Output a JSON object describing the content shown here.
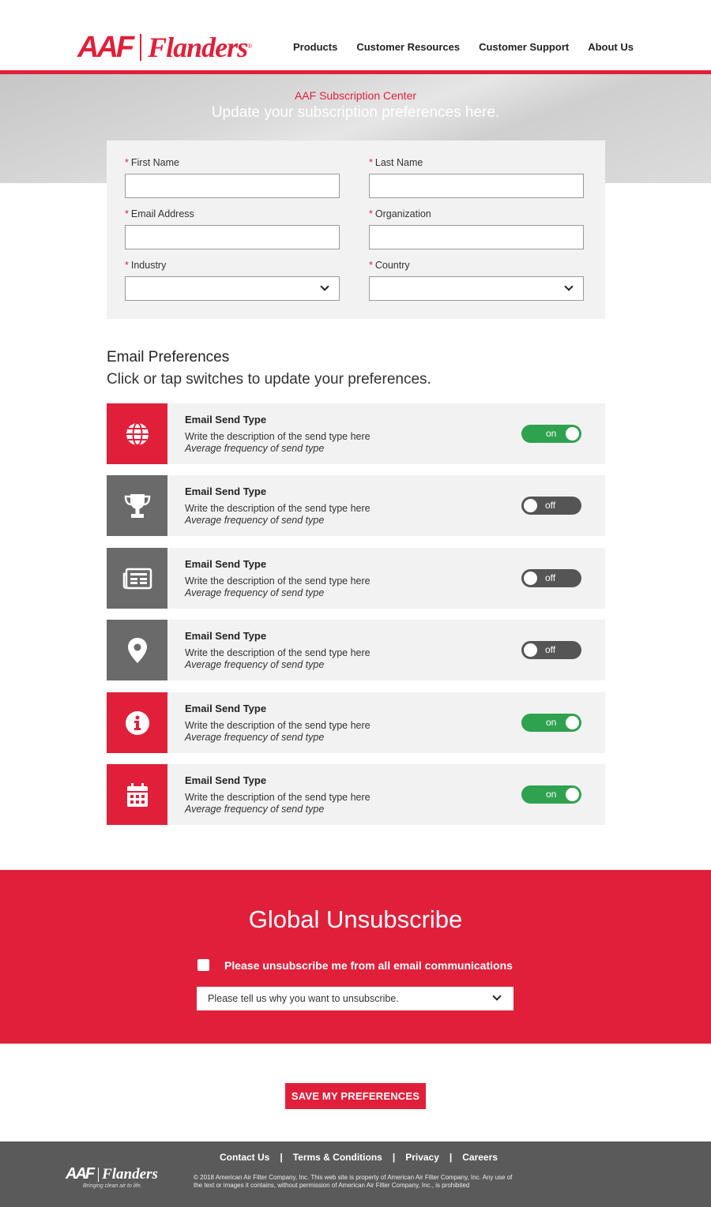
{
  "header": {
    "logo_aaf": "AAF",
    "logo_flanders": "Flanders",
    "logo_reg": "®",
    "nav": [
      "Products",
      "Customer Resources",
      "Customer Support",
      "About Us"
    ]
  },
  "banner": {
    "subtitle": "AAF Subscription Center",
    "title": "Update your subscription preferences here."
  },
  "form": {
    "required_mark": "*",
    "first_name": {
      "label": "First Name",
      "value": ""
    },
    "last_name": {
      "label": "Last Name",
      "value": ""
    },
    "email": {
      "label": "Email Address",
      "value": ""
    },
    "organization": {
      "label": "Organization",
      "value": ""
    },
    "industry": {
      "label": "Industry",
      "value": ""
    },
    "country": {
      "label": "Country",
      "value": ""
    }
  },
  "preferences": {
    "title": "Email Preferences",
    "subtitle": "Click or tap switches to update your preferences.",
    "items": [
      {
        "icon": "globe-icon",
        "icon_color": "#e0203a",
        "name": "Email Send Type",
        "description": "Write the description of the send type here",
        "frequency": "Average frequency of send type",
        "state": "on"
      },
      {
        "icon": "trophy-icon",
        "icon_color": "#6a6a6a",
        "name": "Email Send Type",
        "description": "Write the description of the send type here",
        "frequency": "Average frequency of send type",
        "state": "off"
      },
      {
        "icon": "newspaper-icon",
        "icon_color": "#6a6a6a",
        "name": "Email Send Type",
        "description": "Write the description of the send type here",
        "frequency": "Average frequency of send type",
        "state": "off"
      },
      {
        "icon": "map-pin-icon",
        "icon_color": "#6a6a6a",
        "name": "Email Send Type",
        "description": "Write the description of the send type here",
        "frequency": "Average frequency of send type",
        "state": "off"
      },
      {
        "icon": "info-icon",
        "icon_color": "#e0203a",
        "name": "Email Send Type",
        "description": "Write the description of the send type here",
        "frequency": "Average frequency of send type",
        "state": "on"
      },
      {
        "icon": "calendar-icon",
        "icon_color": "#e0203a",
        "name": "Email Send Type",
        "description": "Write the description of the send type here",
        "frequency": "Average frequency of send type",
        "state": "on"
      }
    ]
  },
  "unsubscribe": {
    "title": "Global Unsubscribe",
    "checkbox_label": "Please unsubscribe me from all email communications",
    "checked": false,
    "reason_placeholder": "Please tell us why you want to unsubscribe."
  },
  "save_label": "SAVE MY PREFERENCES",
  "footer": {
    "logo_aaf": "AAF",
    "logo_flanders": "Flanders",
    "tagline": "Bringing clean air to life.",
    "links": [
      "Contact Us",
      "Terms & Conditions",
      "Privacy",
      "Careers"
    ],
    "separator": "|",
    "copyright": "© 2018 American Air Filter Company, Inc. This web site is property of American Air Filter Company, Inc. Any use of the text or images it contains, without permission of American Air Filter Company, Inc., is prohibited"
  },
  "colors": {
    "brand_red": "#e0203a",
    "toggle_on": "#2fa24f",
    "toggle_off": "#555555",
    "icon_gray": "#6a6a6a",
    "footer_bg": "#5a5a5a"
  }
}
